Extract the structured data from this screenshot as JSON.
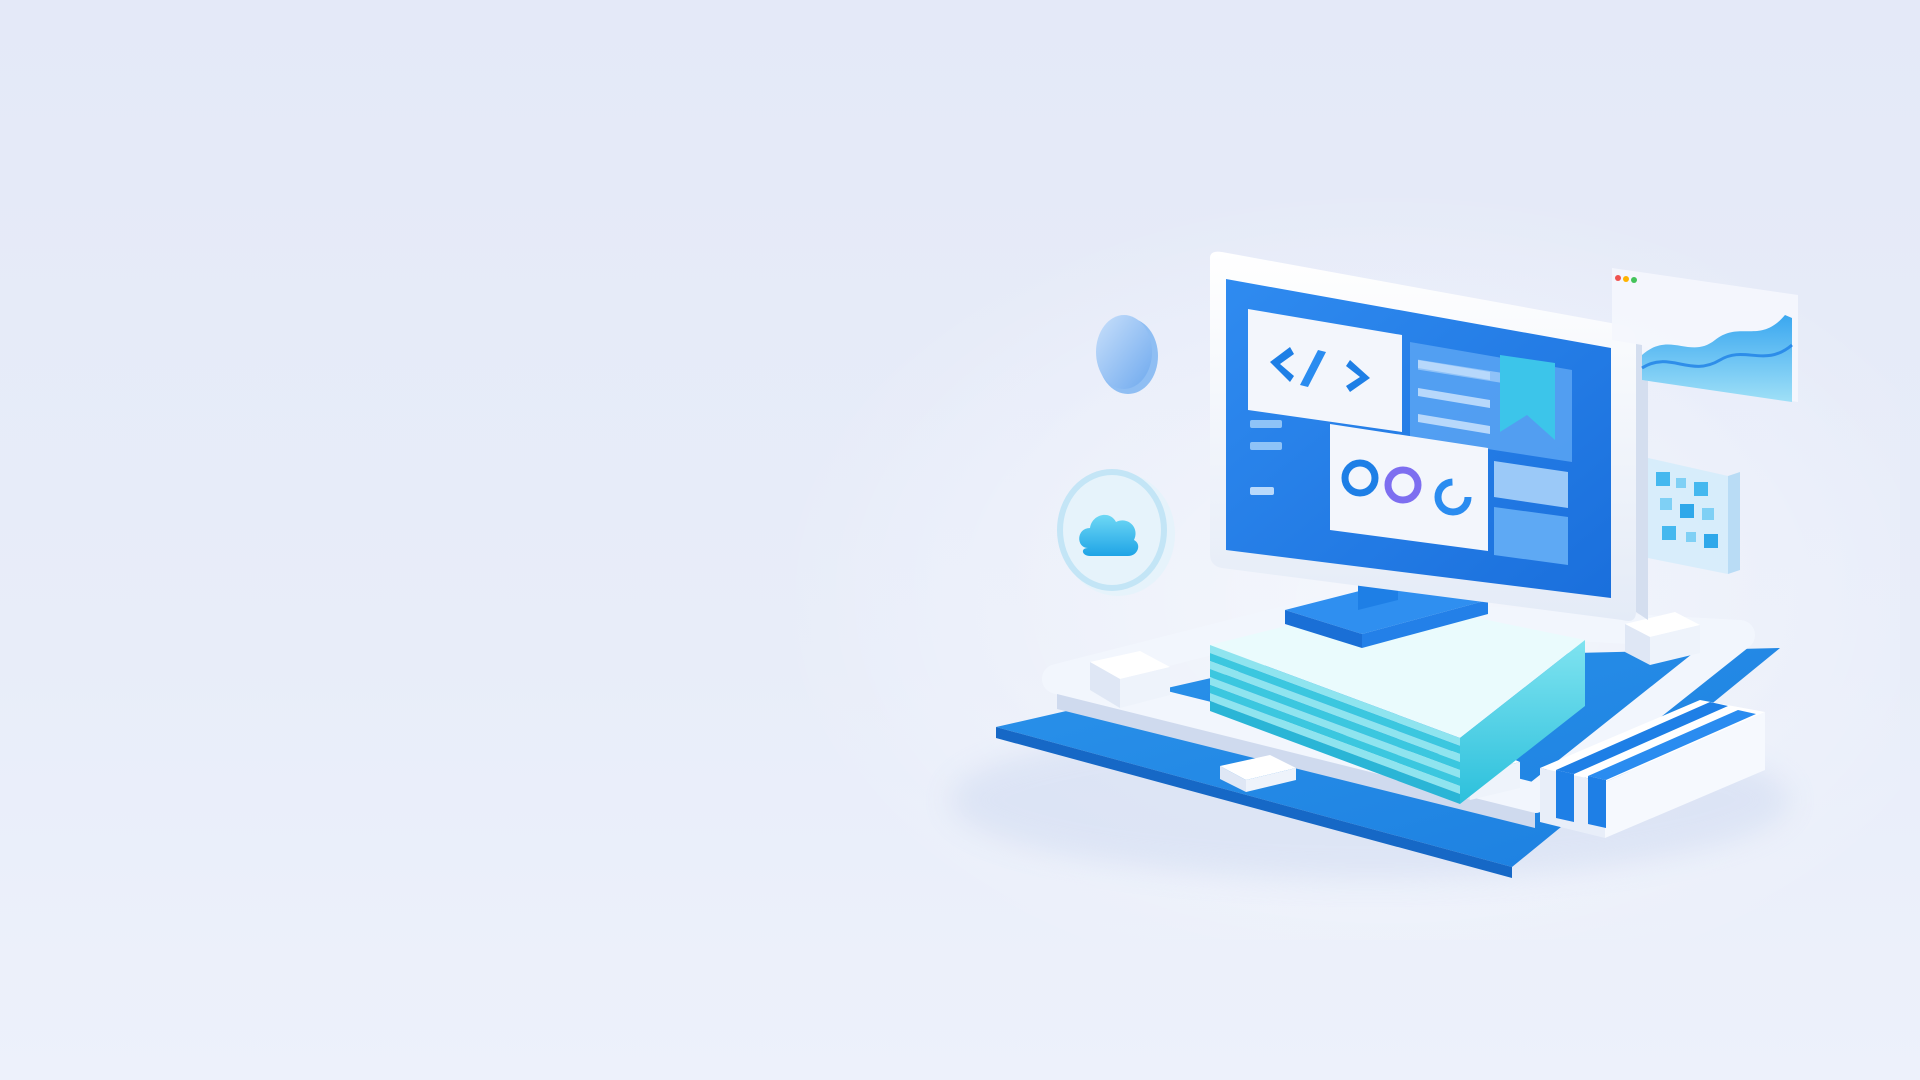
{
  "scene": {
    "description_free": true,
    "colors": {
      "background": "#e6ebf8",
      "accent_blue": "#1e7fe6",
      "screen_blue": "#2a7fe8",
      "cyan": "#3cc8ee",
      "white_panel": "#f5f8fd",
      "window_dot_red": "#ef5350",
      "window_dot_yellow": "#ffb300",
      "window_dot_green": "#43c35a"
    },
    "icons": [
      "code-brackets-icon",
      "bookmark-icon",
      "donut-chart-icon",
      "cloud-icon",
      "area-chart-icon",
      "qr-code-icon"
    ]
  }
}
